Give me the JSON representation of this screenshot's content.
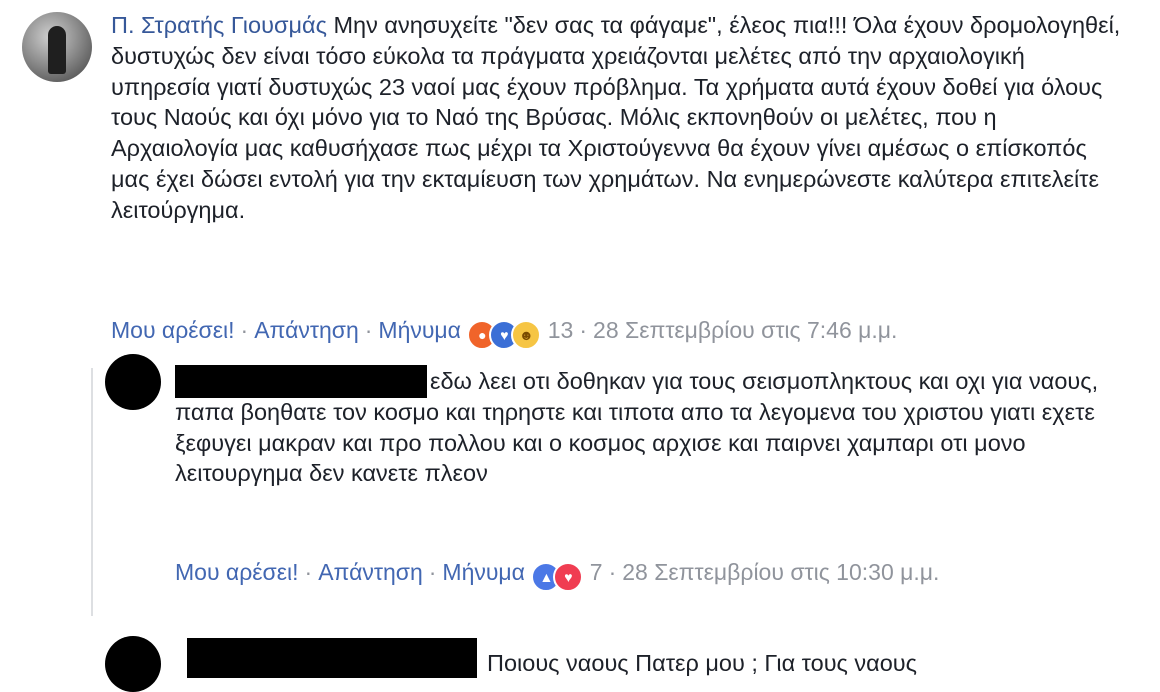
{
  "comments": [
    {
      "author": "Π. Στρατής Γιουσμάς",
      "text": "Μην ανησυχείτε \"δεν σας τα φάγαμε\", έλεος πια!!! Όλα έχουν δρομολογηθεί, δυστυχώς δεν είναι τόσο εύκολα τα πράγματα χρειάζονται μελέτες από την αρχαιολογική υπηρεσία γιατί δυστυχώς 23 ναοί μας έχουν πρόβλημα. Τα χρήματα αυτά έχουν δοθεί για όλους τους Ναούς και όχι μόνο για το Ναό της Βρύσας. Μόλις εκπονηθούν οι μελέτες, που η Αρχαιολογία μας καθυσήχασε πως μέχρι τα Χριστούγεννα θα έχουν γίνει αμέσως ο επίσκοπός μας έχει δώσει εντολή για την εκταμίευση των χρημάτων. Να ενημερώνεστε καλύτερα επιτελείτε λειτούργημα.",
      "like_label": "Μου αρέσει!",
      "reply_label": "Απάντηση",
      "message_label": "Μήνυμα",
      "reaction_icons": [
        "angry-reaction-icon",
        "love-reaction-icon",
        "haha-reaction-icon"
      ],
      "reaction_count": "13",
      "timestamp": "28 Σεπτεμβρίου στις 7:46 μ.μ."
    },
    {
      "author": "",
      "text": "εδω λεει οτι δοθηκαν για τους σεισμοπληκτους και οχι για ναους, παπα βοηθατε τον κοσμο και τηρηστε και τιποτα απο τα λεγομενα του χριστου γιατι εχετε ξεφυγει μακραν και προ πολλου και ο κοσμος αρχισε και παιρνει χαμπαρι οτι μονο λειτουργημα δεν κανετε πλεον",
      "like_label": "Μου αρέσει!",
      "reply_label": "Απάντηση",
      "message_label": "Μήνυμα",
      "reaction_icons": [
        "like-reaction-icon",
        "love-reaction-icon"
      ],
      "reaction_count": "7",
      "timestamp": "28 Σεπτεμβρίου στις 10:30 μ.μ."
    },
    {
      "author": "",
      "text": "Ποιους ναους Πατερ μου ; Για τους ναους"
    }
  ],
  "colors": {
    "author_link": "#365899",
    "action_link": "#4267b2",
    "meta_gray": "#90949c",
    "text": "#1d2129"
  }
}
